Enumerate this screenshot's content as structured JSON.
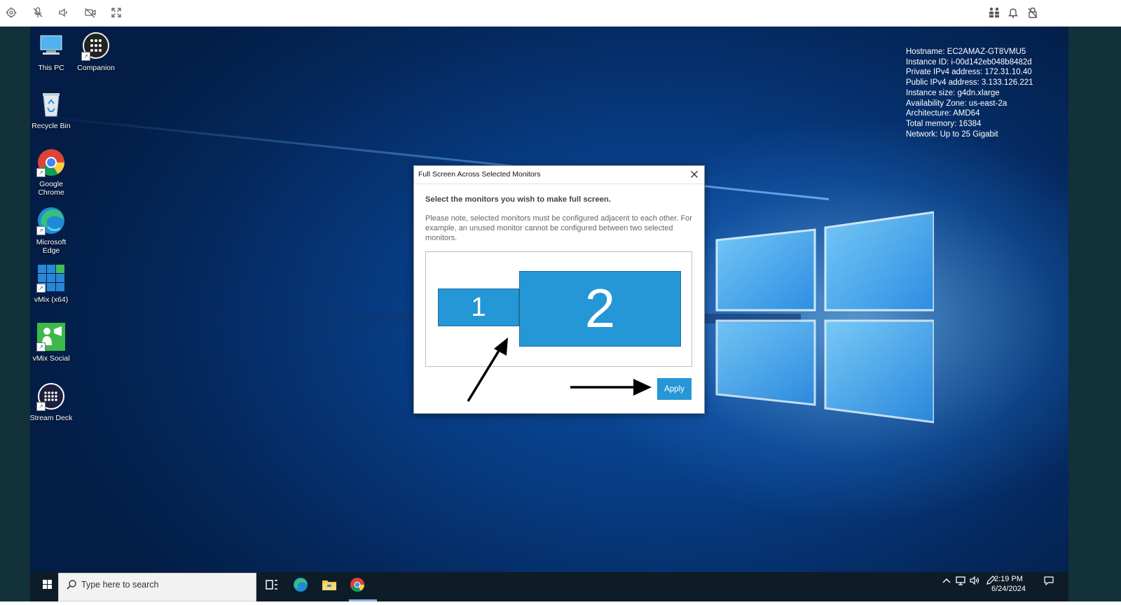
{
  "toolbar": {
    "left_icons": [
      "gear-icon",
      "microphone-muted-icon",
      "speaker-icon",
      "camera-off-icon",
      "expand-icon"
    ],
    "right_icons": [
      "users-icon",
      "bell-icon",
      "lock-icon"
    ]
  },
  "desktop": {
    "icons": [
      {
        "label": "This PC",
        "icon": "this-pc-icon"
      },
      {
        "label": "Companion",
        "icon": "companion-icon"
      },
      {
        "label": "Recycle Bin",
        "icon": "recycle-bin-icon"
      },
      {
        "label": "Google Chrome",
        "icon": "chrome-icon"
      },
      {
        "label": "Microsoft Edge",
        "icon": "edge-icon"
      },
      {
        "label": "vMix (x64)",
        "icon": "vmix-icon"
      },
      {
        "label": "vMix Social",
        "icon": "vmix-social-icon"
      },
      {
        "label": "Stream Deck",
        "icon": "stream-deck-icon"
      }
    ],
    "sysinfo": [
      "Hostname: EC2AMAZ-GT8VMU5",
      "Instance ID: i-00d142eb048b8482d",
      "Private IPv4 address: 172.31.10.40",
      "Public IPv4 address: 3.133.126.221",
      "Instance size: g4dn.xlarge",
      "Availability Zone: us-east-2a",
      "Architecture: AMD64",
      "Total memory: 16384",
      "Network: Up to 25 Gigabit"
    ]
  },
  "dialog": {
    "title": "Full Screen Across Selected Monitors",
    "heading": "Select the monitors you wish to make full screen.",
    "note": "Please note, selected monitors must be configured adjacent to each other. For example, an unused monitor cannot be configured between two selected monitors.",
    "monitors": [
      {
        "label": "1"
      },
      {
        "label": "2"
      }
    ],
    "apply_label": "Apply",
    "accent_color": "#2597d6"
  },
  "taskbar": {
    "search_placeholder": "Type here to search",
    "pinned": [
      "task-view-icon",
      "edge-icon",
      "file-explorer-icon",
      "chrome-icon"
    ],
    "clock_time": "2:19 PM",
    "clock_date": "6/24/2024"
  }
}
